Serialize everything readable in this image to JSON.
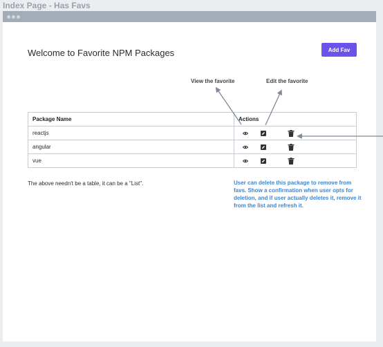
{
  "frame_title": "Index Page - Has Favs",
  "page": {
    "heading": "Welcome to Favorite NPM Packages",
    "add_button": "Add Fav"
  },
  "annotations": {
    "view": "View the favorite",
    "edit": "Edit the favorite",
    "delete_note": "User can delete this package to remove from favs. Show a confirmation when user opts for deletion, and if user actually deletes it, remove it from the list and refresh it.",
    "list_note": "The above needn't be a table, it can be a \"List\"."
  },
  "table": {
    "headers": [
      "Package Name",
      "Actions"
    ],
    "rows": [
      {
        "name": "reactjs"
      },
      {
        "name": "angular"
      },
      {
        "name": "vue"
      }
    ]
  },
  "icons": {
    "view": "eye-icon",
    "edit": "edit-icon",
    "delete": "trash-icon"
  },
  "colors": {
    "accent": "#6b52e8",
    "note_blue": "#3a86d6",
    "browser_bar": "#a3adb7"
  }
}
